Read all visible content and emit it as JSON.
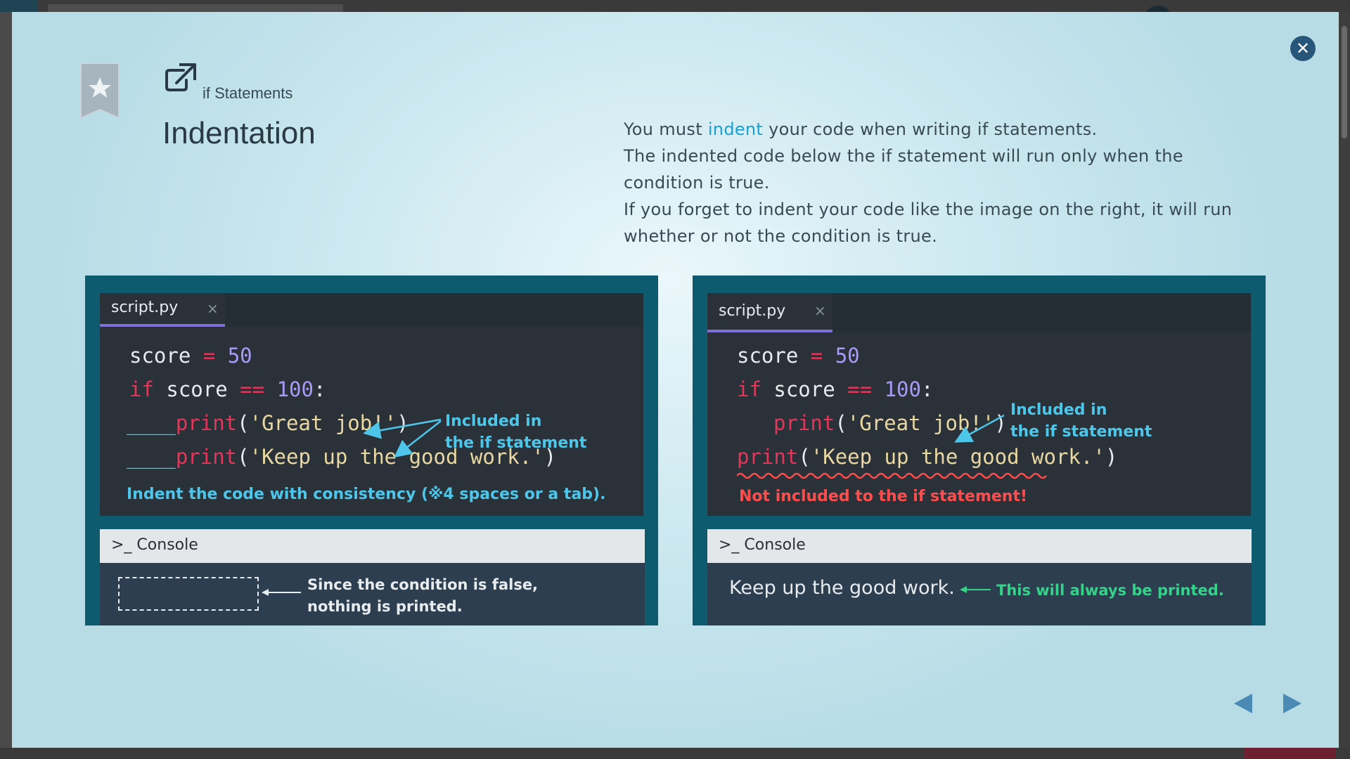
{
  "lesson": {
    "category": "if Statements",
    "title": "Indentation"
  },
  "description": {
    "line1_before": "You must ",
    "line1_highlight": "indent",
    "line1_after": " your code when writing if statements.",
    "line2": "The indented code below the if statement will run only when the condition is true.",
    "line3": "If you forget to indent your code like the image on the right, it will run whether or not the condition is true."
  },
  "left_panel": {
    "tab_name": "script.py",
    "tab_close": "×",
    "code": {
      "l1_var": "score",
      "l1_op": "=",
      "l1_val": "50",
      "l2_kw": "if",
      "l2_var": "score",
      "l2_op": "==",
      "l2_val": "100",
      "l2_colon": ":",
      "indent_marker": "____",
      "l3_func": "print",
      "l3_open": "(",
      "l3_str": "'Great job!'",
      "l3_close": ")",
      "l4_func": "print",
      "l4_open": "(",
      "l4_str": "'Keep up the good work.'",
      "l4_close": ")"
    },
    "annotation_line1": "Included in",
    "annotation_line2": "the if statement",
    "footnote": "Indent the code with consistency (※4 spaces or a tab).",
    "console_label": ">_ Console",
    "console_note_line1": "Since the condition is false,",
    "console_note_line2": "nothing is printed."
  },
  "right_panel": {
    "tab_name": "script.py",
    "tab_close": "×",
    "code": {
      "l1_var": "score",
      "l1_op": "=",
      "l1_val": "50",
      "l2_kw": "if",
      "l2_var": "score",
      "l2_op": "==",
      "l2_val": "100",
      "l2_colon": ":",
      "l3_func": "print",
      "l3_open": "(",
      "l3_str": "'Great job!'",
      "l3_close": ")",
      "l4_func": "print",
      "l4_open": "(",
      "l4_str": "'Keep up the good work.'",
      "l4_close": ")"
    },
    "annotation_line1": "Included in",
    "annotation_line2": "the if statement",
    "error_note": "Not included to the if statement!",
    "console_label": ">_ Console",
    "console_output": "Keep up the good work.",
    "console_note": "This will always be printed."
  },
  "colors": {
    "accent": "#1a9fd1",
    "panel_bg": "#0e5a6e",
    "editor_bg": "#2b3138",
    "keyword": "#e2365b",
    "number": "#a99af7",
    "string": "#e9d8a2",
    "annotation": "#4ec6ea",
    "error": "#ff4d4d",
    "success": "#35d38a"
  },
  "icons": {
    "close": "close-circle-icon",
    "bookmark": "bookmark-star-icon",
    "external": "external-link-icon",
    "prev": "triangle-left-icon",
    "next": "triangle-right-icon"
  }
}
